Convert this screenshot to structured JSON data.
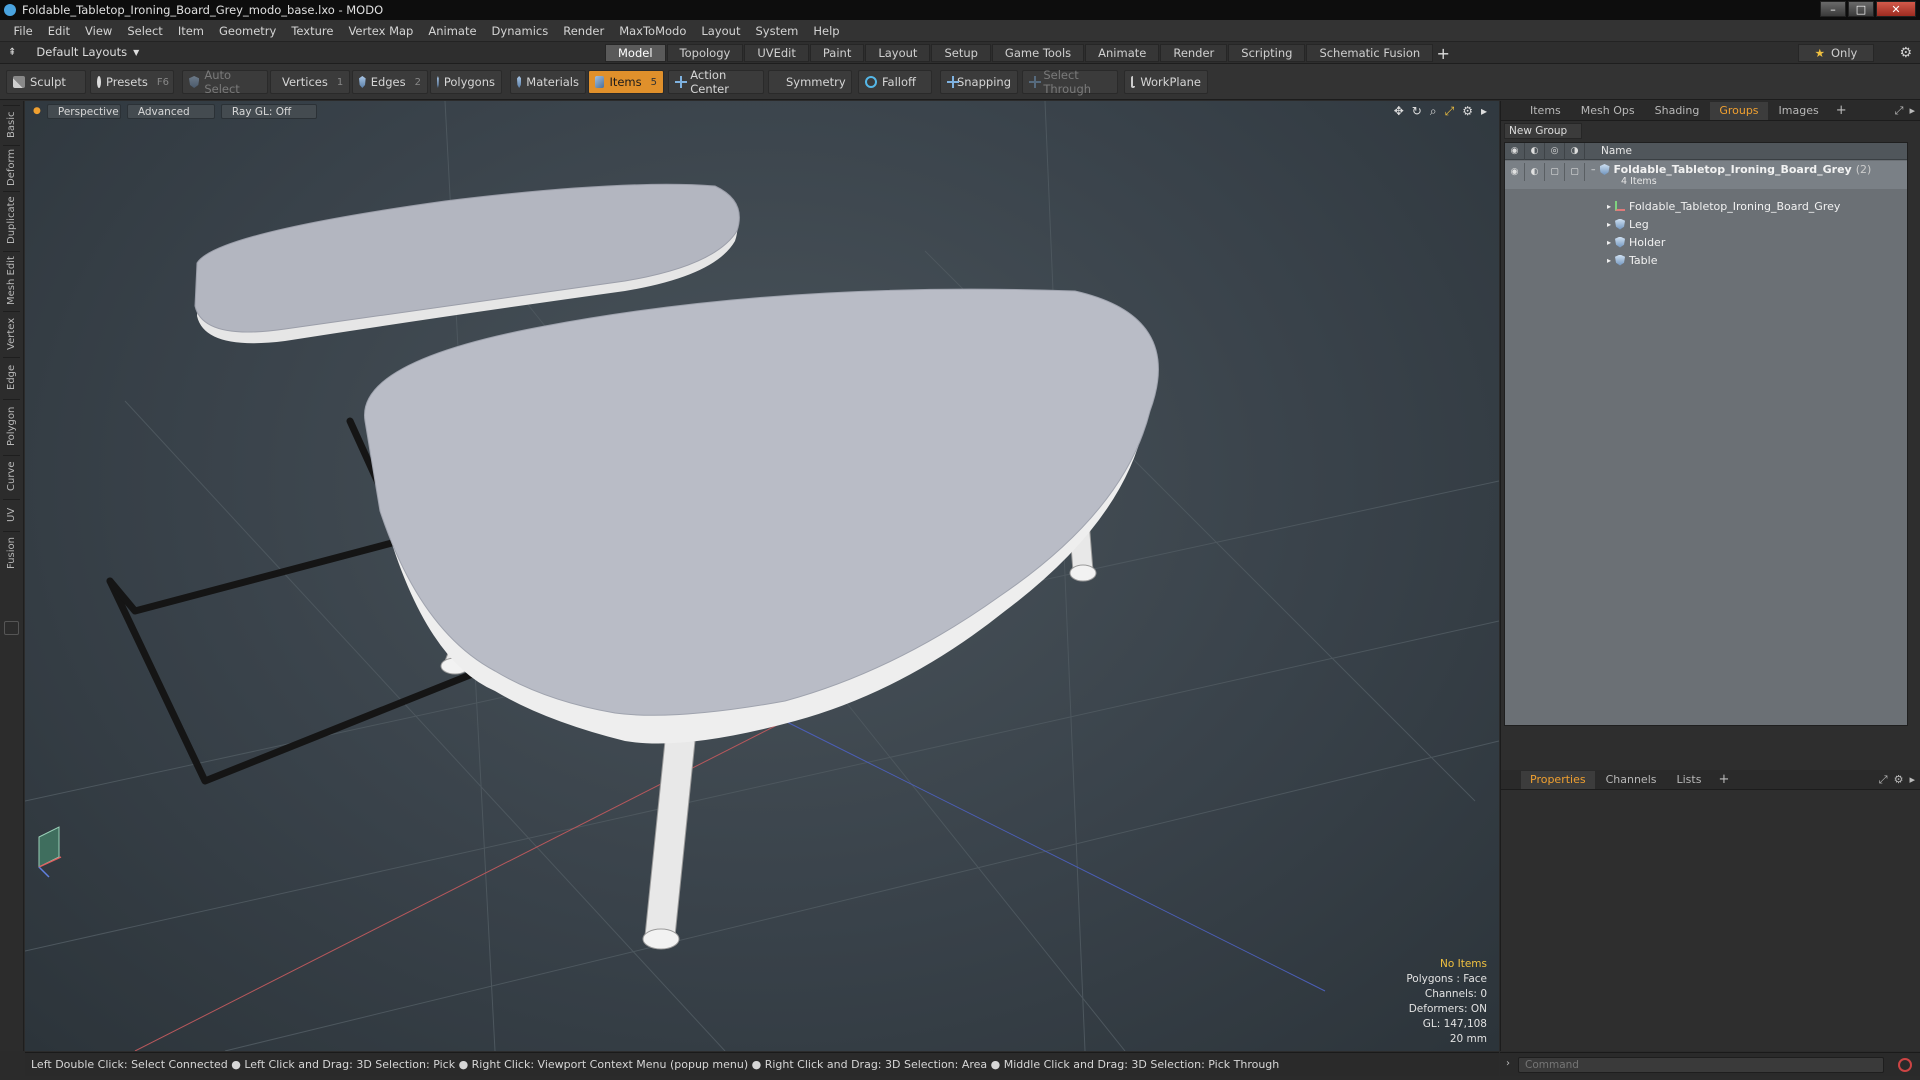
{
  "window": {
    "title": "Foldable_Tabletop_Ironing_Board_Grey_modo_base.lxo - MODO"
  },
  "menu": [
    "File",
    "Edit",
    "View",
    "Select",
    "Item",
    "Geometry",
    "Texture",
    "Vertex Map",
    "Animate",
    "Dynamics",
    "Render",
    "MaxToModo",
    "Layout",
    "System",
    "Help"
  ],
  "layout": {
    "selector": "Default Layouts",
    "tabs": [
      "Model",
      "Topology",
      "UVEdit",
      "Paint",
      "Layout",
      "Setup",
      "Game Tools",
      "Animate",
      "Render",
      "Scripting",
      "Schematic Fusion"
    ],
    "active_tab": "Model",
    "only_label": "Only"
  },
  "toolbar": {
    "sculpt": "Sculpt",
    "presets": "Presets",
    "presets_key": "F6",
    "auto_select": "Auto Select",
    "vertices": "Vertices",
    "vertices_key": "1",
    "edges": "Edges",
    "edges_key": "2",
    "polygons": "Polygons",
    "materials": "Materials",
    "items": "Items",
    "items_key": "5",
    "action_center": "Action Center",
    "symmetry": "Symmetry",
    "falloff": "Falloff",
    "snapping": "Snapping",
    "select_through": "Select Through",
    "workplane": "WorkPlane"
  },
  "left_tabs": [
    "Basic",
    "Deform",
    "Duplicate",
    "Mesh Edit",
    "Vertex",
    "Edge",
    "Polygon",
    "Curve",
    "UV",
    "Fusion"
  ],
  "viewport": {
    "view_mode": "Perspective",
    "shading": "Advanced",
    "raygl": "Ray GL: Off",
    "stats": {
      "selection": "No Items",
      "polygons": "Polygons : Face",
      "channels": "Channels: 0",
      "deformers": "Deformers: ON",
      "gl": "GL: 147,108",
      "scale": "20 mm"
    }
  },
  "status_bar": "Left Double Click: Select Connected ● Left Click and Drag: 3D Selection: Pick ● Right Click: Viewport Context Menu (popup menu) ● Right Click and Drag: 3D Selection: Area ● Middle Click and Drag: 3D Selection: Pick Through",
  "right_panel": {
    "tabs": [
      "Items",
      "Mesh Ops",
      "Shading",
      "Groups",
      "Images"
    ],
    "active_tab": "Groups",
    "new_group": "New Group",
    "column_name": "Name",
    "group": {
      "name": "Foldable_Tabletop_Ironing_Board_Grey",
      "count": "(2)",
      "sub": "4 Items"
    },
    "children": [
      "Foldable_Tabletop_Ironing_Board_Grey",
      "Leg",
      "Holder",
      "Table"
    ],
    "bottom_tabs": [
      "Properties",
      "Channels",
      "Lists"
    ],
    "bottom_active": "Properties"
  },
  "command": {
    "placeholder": "Command"
  }
}
